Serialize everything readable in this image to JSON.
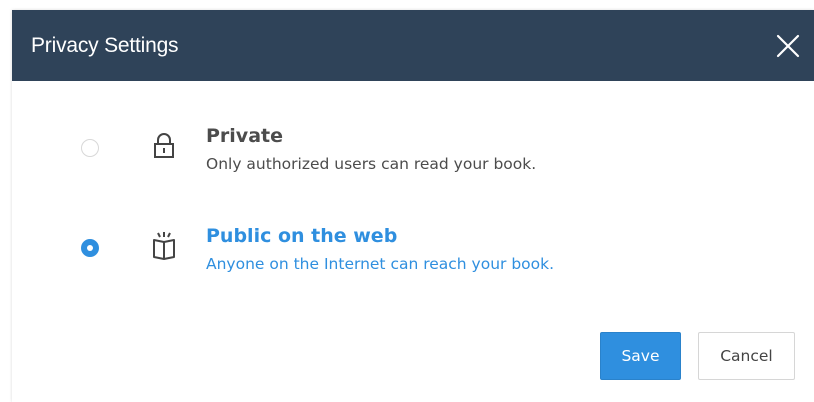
{
  "dialog": {
    "title": "Privacy Settings",
    "close_icon": "close-icon"
  },
  "options": [
    {
      "id": "private",
      "title": "Private",
      "description": "Only authorized users can read your book.",
      "icon": "lock-icon",
      "selected": false
    },
    {
      "id": "public",
      "title": "Public on the web",
      "description": "Anyone on the Internet can reach your book.",
      "icon": "open-book-icon",
      "selected": true
    }
  ],
  "buttons": {
    "save_label": "Save",
    "cancel_label": "Cancel"
  },
  "colors": {
    "header_bg": "#2f4359",
    "accent": "#2f8fdf",
    "text": "#4c4c4c"
  }
}
